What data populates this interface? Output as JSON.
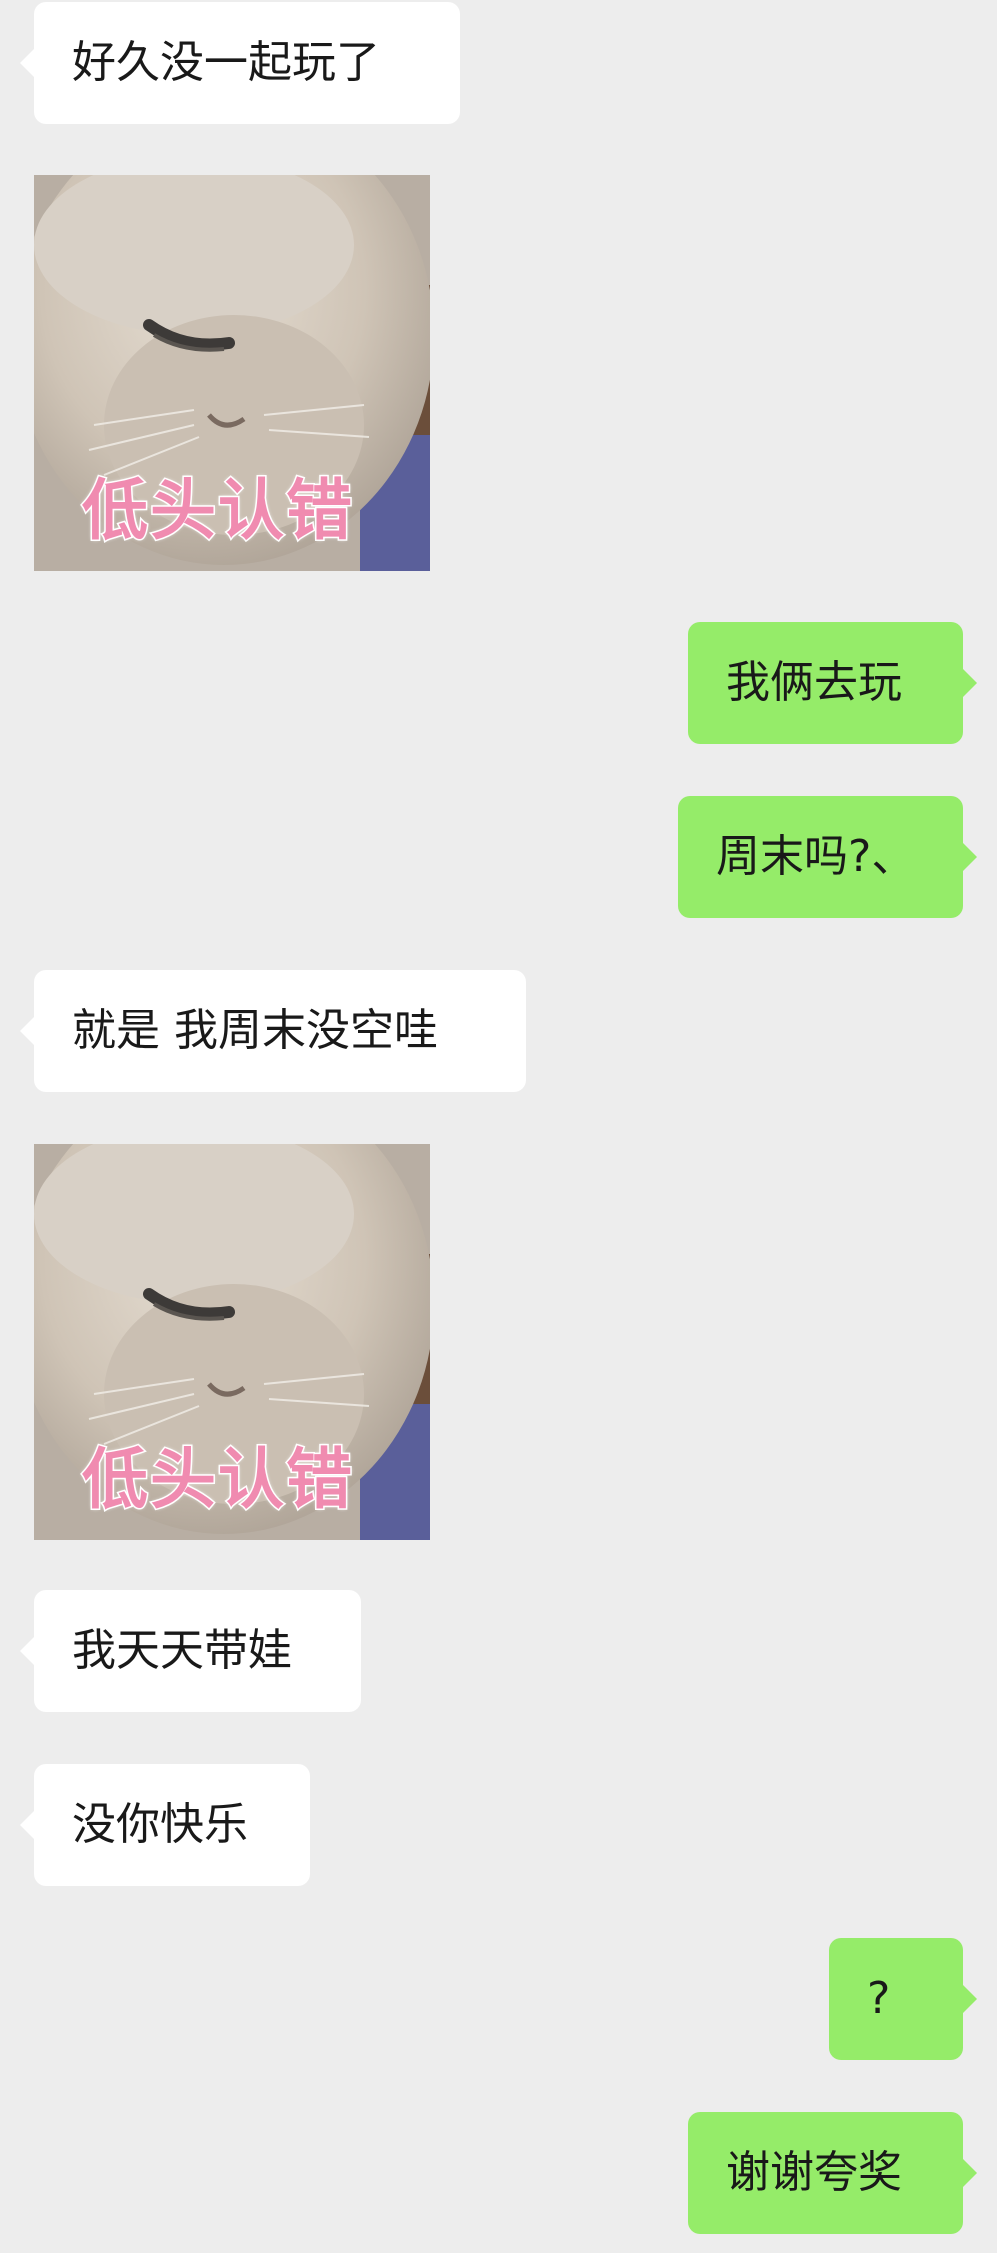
{
  "messages": [
    {
      "side": "in",
      "type": "text",
      "text": "好久没一起玩了"
    },
    {
      "side": "in",
      "type": "sticker",
      "icon": "cat-bowing-head-sticker",
      "caption": "低头认错"
    },
    {
      "side": "out",
      "type": "text",
      "text": "我俩去玩"
    },
    {
      "side": "out",
      "type": "text",
      "text": "周末吗?、"
    },
    {
      "side": "in",
      "type": "text",
      "text": "就是 我周末没空哇"
    },
    {
      "side": "in",
      "type": "sticker",
      "icon": "cat-bowing-head-sticker",
      "caption": "低头认错"
    },
    {
      "side": "in",
      "type": "text",
      "text": "我天天带娃"
    },
    {
      "side": "in",
      "type": "text",
      "text": "没你快乐"
    },
    {
      "side": "out",
      "type": "text",
      "text": "?"
    },
    {
      "side": "out",
      "type": "text",
      "text": "谢谢夸奖"
    }
  ],
  "colors": {
    "background": "#ededed",
    "incoming_bubble": "#ffffff",
    "outgoing_bubble": "#95ec69",
    "caption_pink": "#f08bb0"
  }
}
